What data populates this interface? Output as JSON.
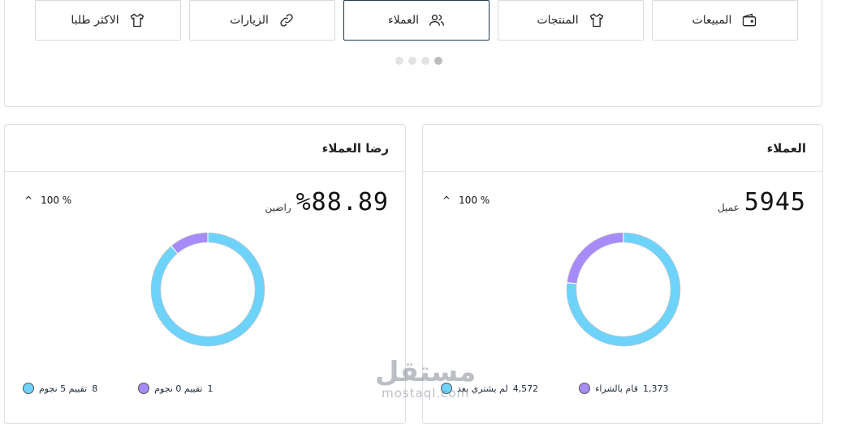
{
  "tabs": [
    {
      "label": "المبيعات",
      "icon": "wallet-icon",
      "active": false
    },
    {
      "label": "المنتجات",
      "icon": "tshirt-icon",
      "active": false
    },
    {
      "label": "العملاء",
      "icon": "users-icon",
      "active": true
    },
    {
      "label": "الزيارات",
      "icon": "link-icon",
      "active": false
    },
    {
      "label": "الاكثر طلبا",
      "icon": "tshirt-icon",
      "active": false
    }
  ],
  "carousel": {
    "pages": 4,
    "active_index": 3
  },
  "customers_card": {
    "title": "العملاء",
    "value": "5945",
    "unit": "عميل",
    "change": "100 %",
    "legend": [
      {
        "count": "4,572",
        "label": "لم يشتري بعد",
        "color": "#6dd3fb"
      },
      {
        "count": "1,373",
        "label": "قام بالشراء",
        "color": "#a78bfa"
      }
    ]
  },
  "satisfaction_card": {
    "title": "رضا العملاء",
    "value": "%88.89",
    "unit": "راضين",
    "change": "100 %",
    "legend": [
      {
        "count": "8",
        "label": "تقييم 5 نجوم",
        "color": "#6dd3fb"
      },
      {
        "count": "1",
        "label": "تقييم 0 نجوم",
        "color": "#a78bfa"
      }
    ]
  },
  "chart_data": [
    {
      "type": "pie",
      "categories": [
        "لم يشتري بعد",
        "قام بالشراء"
      ],
      "values": [
        4572,
        1373
      ],
      "title": "العملاء"
    },
    {
      "type": "pie",
      "categories": [
        "تقييم 5 نجوم",
        "تقييم 0 نجوم"
      ],
      "values": [
        8,
        1
      ],
      "title": "رضا العملاء"
    }
  ],
  "watermark": {
    "arabic": "مستقل",
    "latin": "mostaql.com"
  }
}
